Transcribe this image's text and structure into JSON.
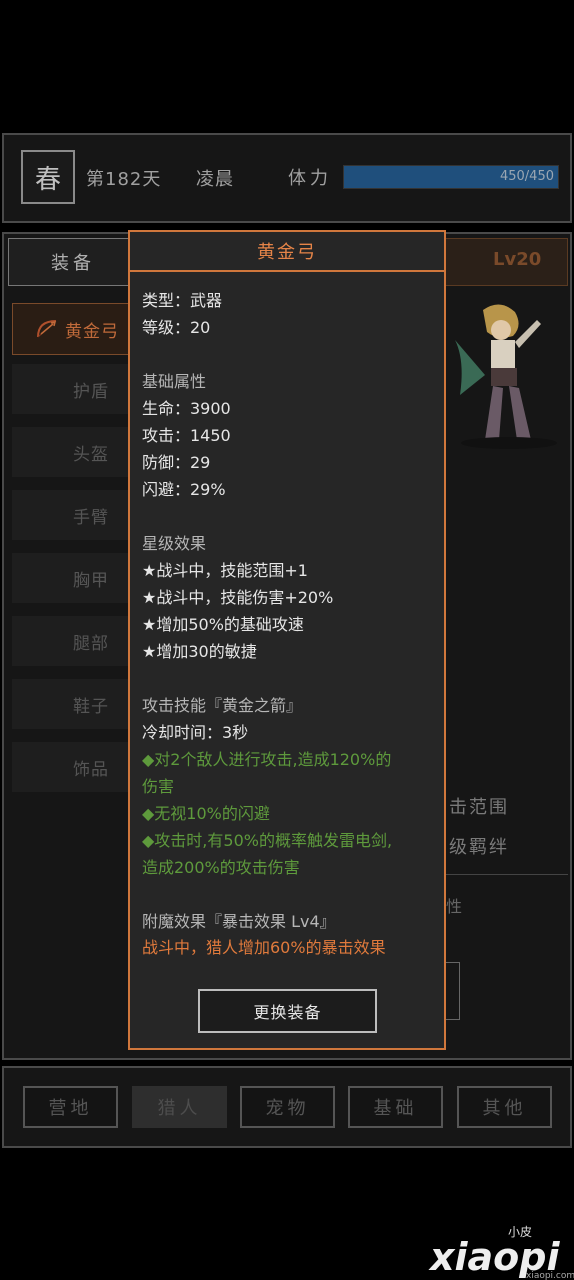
{
  "header": {
    "season": "春",
    "day": "第182天",
    "time_of_day": "凌晨",
    "stamina_label": "体力",
    "stamina_text": "450/450",
    "stamina_fraction": 1.0
  },
  "tabs": {
    "equipment": "装备",
    "level": "Lv20"
  },
  "slots": [
    {
      "label": "黄金弓",
      "selected": true
    },
    {
      "label": "护盾"
    },
    {
      "label": "头盔"
    },
    {
      "label": "手臂"
    },
    {
      "label": "胸甲"
    },
    {
      "label": "腿部"
    },
    {
      "label": "鞋子"
    },
    {
      "label": "饰品"
    }
  ],
  "background_text": {
    "range": "击范围",
    "bond": "级羁绊",
    "partial": "性"
  },
  "popup": {
    "title": "黄金弓",
    "type": "类型：武器",
    "level": "等级：20",
    "base_header": "基础属性",
    "hp": "生命：3900",
    "atk": "攻击：1450",
    "def": "防御：29",
    "dodge": "闪避：29%",
    "star_header": "星级效果",
    "star_1": "★战斗中，技能范围+1",
    "star_2": "★战斗中，技能伤害+20%",
    "star_3": "★增加50%的基础攻速",
    "star_4": "★增加30的敏捷",
    "skill_header": "攻击技能『黄金之箭』",
    "cooldown": "冷却时间：3秒",
    "skill_1a": "◆对2个敌人进行攻击,造成120%的",
    "skill_1b": "伤害",
    "skill_2": "◆无视10%的闪避",
    "skill_3a": "◆攻击时,有50%的概率触发雷电剑,",
    "skill_3b": "造成200%的攻击伤害",
    "enchant_header": "附魔效果『暴击效果 Lv4』",
    "enchant_desc": "战斗中，猎人增加60%的暴击效果",
    "swap_button": "更换装备"
  },
  "nav": {
    "camp": "营地",
    "hunter": "猎人",
    "pet": "宠物",
    "basic": "基础",
    "other": "其他"
  },
  "watermark": {
    "small": "小皮",
    "big": "xiaopi",
    "url": "xiaopi.com"
  },
  "colors": {
    "accent": "#d0773c",
    "green_text": "#5e9a3c",
    "stamina_fill": "#1f4f7c"
  }
}
